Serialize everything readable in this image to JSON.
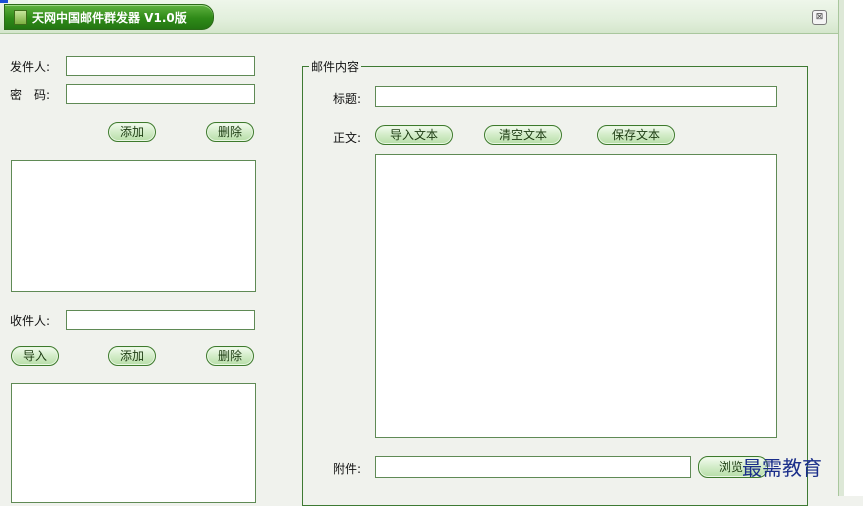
{
  "window": {
    "title": "天网中国邮件群发器 V1.0版",
    "close_glyph": "⊠"
  },
  "sender": {
    "sender_label": "发件人:",
    "password_label": "密　码:",
    "sender_value": "",
    "password_value": "",
    "add_label": "添加",
    "delete_label": "删除"
  },
  "recipient": {
    "label": "收件人:",
    "value": "",
    "import_label": "导入",
    "add_label": "添加",
    "delete_label": "删除"
  },
  "mail": {
    "group_title": "邮件内容",
    "subject_label": "标题:",
    "subject_value": "",
    "body_label": "正文:",
    "import_text_label": "导入文本",
    "clear_text_label": "清空文本",
    "save_text_label": "保存文本",
    "attachment_label": "附件:",
    "attachment_value": "",
    "browse_label": "浏览"
  },
  "watermark": "最需教育",
  "colors": {
    "title_green": "#2f8a18",
    "border_green": "#5f8a55",
    "background": "#f0f2ed"
  }
}
